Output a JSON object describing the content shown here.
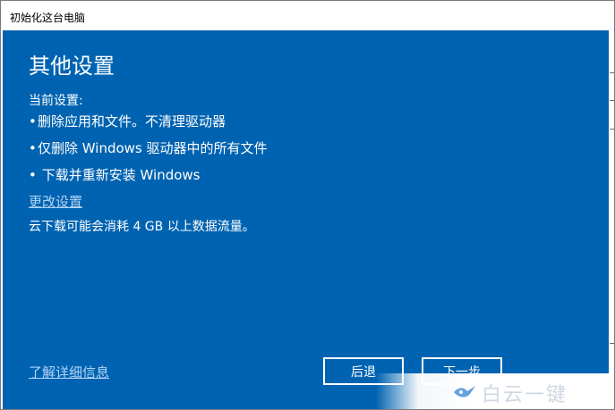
{
  "window": {
    "title": "初始化这台电脑"
  },
  "main": {
    "heading": "其他设置",
    "current_settings_label": "当前设置:",
    "settings": [
      "删除应用和文件。不清理驱动器",
      "仅删除 Windows 驱动器中的所有文件",
      " 下载并重新安装 Windows"
    ],
    "bullet_char": "•",
    "change_settings_link": "更改设置",
    "data_usage_note": "云下载可能会消耗 4 GB 以上数据流量。",
    "learn_more_link": "了解详细信息"
  },
  "buttons": {
    "back_label": "后退",
    "next_label": "下一步"
  },
  "watermark": {
    "icon": "bird-logo-icon",
    "text": "白云一键"
  },
  "colors": {
    "content_background": "#0063b1",
    "link_color": "#b3d4f5",
    "text": "#ffffff"
  }
}
